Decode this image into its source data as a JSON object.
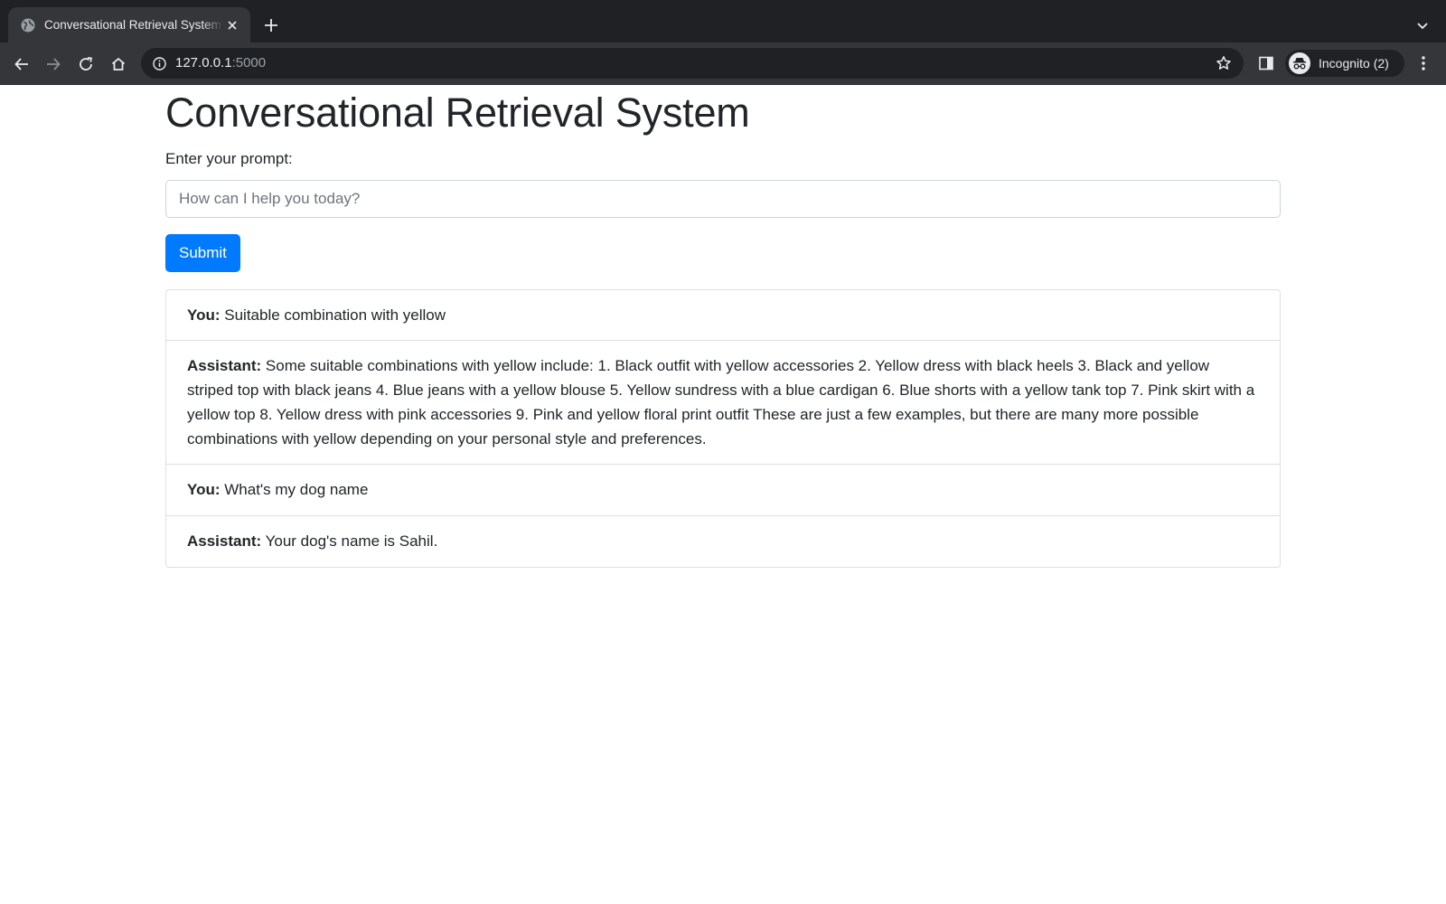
{
  "browser": {
    "tab_title": "Conversational Retrieval System",
    "url_host": "127.0.0.1",
    "url_port": ":5000",
    "profile_label": "Incognito (2)"
  },
  "page": {
    "title": "Conversational Retrieval System",
    "prompt_label": "Enter your prompt:",
    "prompt_placeholder": "How can I help you today?",
    "prompt_value": "",
    "submit_label": "Submit"
  },
  "chat": {
    "messages": [
      {
        "speaker": "You:",
        "text": "Suitable combination with yellow"
      },
      {
        "speaker": "Assistant:",
        "text": "Some suitable combinations with yellow include: 1. Black outfit with yellow accessories 2. Yellow dress with black heels 3. Black and yellow striped top with black jeans 4. Blue jeans with a yellow blouse 5. Yellow sundress with a blue cardigan 6. Blue shorts with a yellow tank top 7. Pink skirt with a yellow top 8. Yellow dress with pink accessories 9. Pink and yellow floral print outfit These are just a few examples, but there are many more possible combinations with yellow depending on your personal style and preferences."
      },
      {
        "speaker": "You:",
        "text": "What's my dog name"
      },
      {
        "speaker": "Assistant:",
        "text": "Your dog's name is Sahil."
      }
    ]
  },
  "icons": {
    "tab_favicon": "globe-icon",
    "tab_close": "close-icon",
    "new_tab": "plus-icon",
    "tab_search": "chevron-down-icon",
    "back": "arrow-left-icon",
    "forward": "arrow-right-icon",
    "reload": "reload-icon",
    "home": "home-icon",
    "site_info": "info-icon",
    "bookmark": "star-icon",
    "side_panel": "side-panel-icon",
    "incognito": "incognito-icon",
    "menu": "kebab-menu-icon"
  },
  "colors": {
    "tabstrip_bg": "#202124",
    "toolbar_bg": "#35363a",
    "primary_button": "#007bff",
    "text": "#212529",
    "border": "#dfdfdf"
  }
}
